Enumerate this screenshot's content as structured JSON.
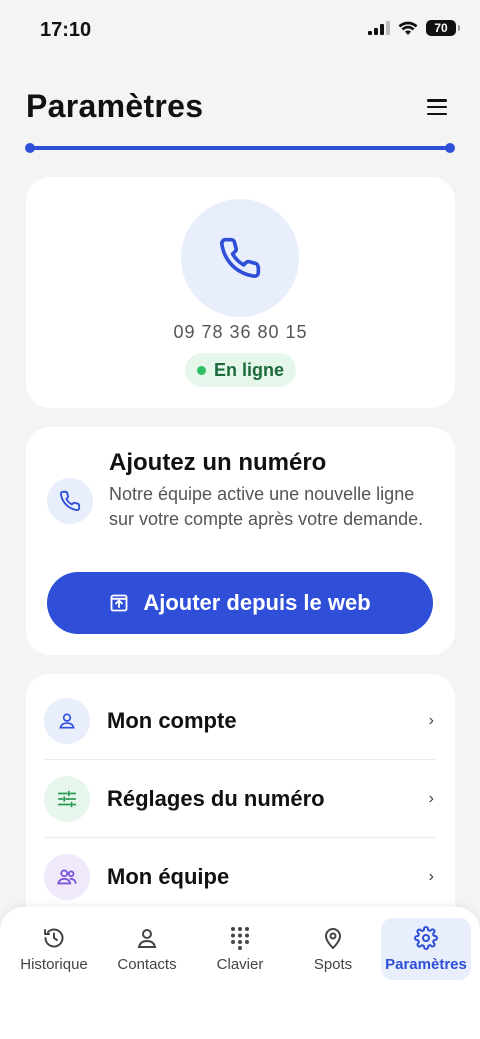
{
  "status_bar": {
    "time": "17:10",
    "battery": "70"
  },
  "header": {
    "title": "Paramètres"
  },
  "phone_card": {
    "number": "09 78 36 80 15",
    "status": "En ligne",
    "status_color": "#2fbf63"
  },
  "add_number_card": {
    "title": "Ajoutez un numéro",
    "description": "Notre équipe active une nouvelle ligne sur votre compte après votre demande.",
    "button_label": "Ajouter depuis le web"
  },
  "settings_menu": [
    {
      "label": "Mon compte",
      "icon": "person-icon"
    },
    {
      "label": "Réglages du numéro",
      "icon": "sliders-icon"
    },
    {
      "label": "Mon équipe",
      "icon": "team-icon"
    }
  ],
  "bottom_nav": [
    {
      "label": "Historique",
      "icon": "history-icon"
    },
    {
      "label": "Contacts",
      "icon": "contact-icon"
    },
    {
      "label": "Clavier",
      "icon": "keypad-icon"
    },
    {
      "label": "Spots",
      "icon": "location-pin-icon"
    },
    {
      "label": "Paramètres",
      "icon": "gear-icon",
      "active": true
    }
  ],
  "colors": {
    "accent": "#2f4fd8",
    "background": "#f4f4f3"
  }
}
